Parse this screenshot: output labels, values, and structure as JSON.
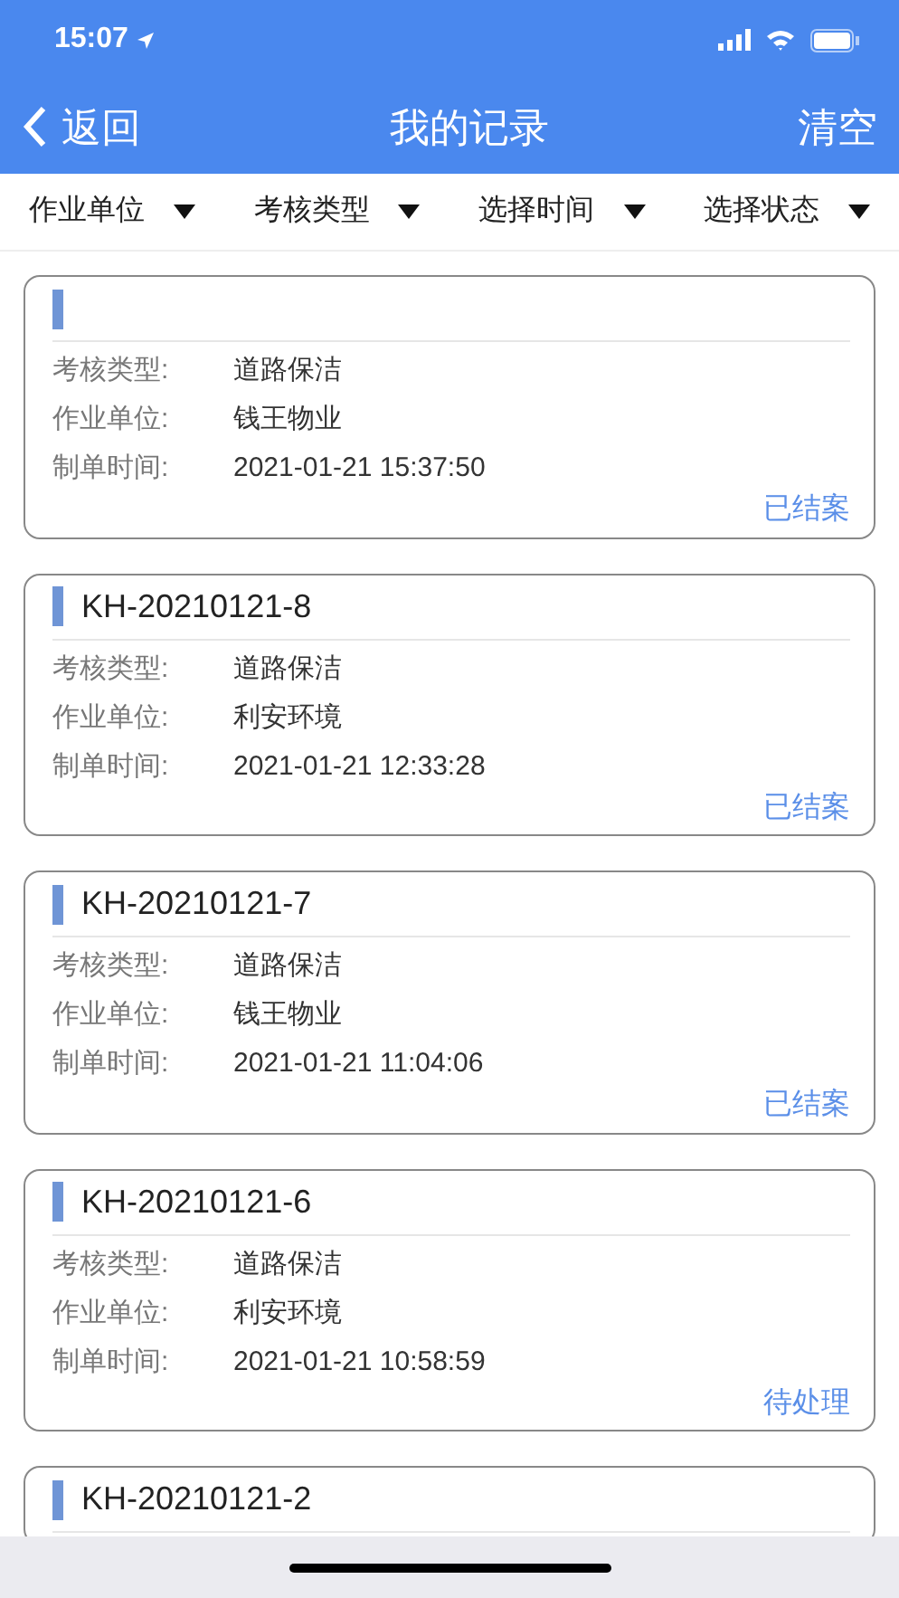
{
  "status_bar": {
    "time": "15:07"
  },
  "header": {
    "back": "返回",
    "title": "我的记录",
    "action": "清空"
  },
  "filters": [
    {
      "label": "作业单位"
    },
    {
      "label": "考核类型"
    },
    {
      "label": "选择时间"
    },
    {
      "label": "选择状态"
    }
  ],
  "records": [
    {
      "fields": [
        {
          "label": "考核类型:",
          "value": "道路保洁"
        },
        {
          "label": "作业单位:",
          "value": "钱王物业"
        },
        {
          "label": "制单时间:",
          "value": "2021-01-21 15:37:50"
        }
      ],
      "status": "已结案"
    },
    {
      "number": "KH-20210121-8",
      "fields": [
        {
          "label": "考核类型:",
          "value": "道路保洁"
        },
        {
          "label": "作业单位:",
          "value": "利安环境"
        },
        {
          "label": "制单时间:",
          "value": "2021-01-21 12:33:28"
        }
      ],
      "status": "已结案"
    },
    {
      "number": "KH-20210121-7",
      "fields": [
        {
          "label": "考核类型:",
          "value": "道路保洁"
        },
        {
          "label": "作业单位:",
          "value": "钱王物业"
        },
        {
          "label": "制单时间:",
          "value": "2021-01-21 11:04:06"
        }
      ],
      "status": "已结案"
    },
    {
      "number": "KH-20210121-6",
      "fields": [
        {
          "label": "考核类型:",
          "value": "道路保洁"
        },
        {
          "label": "作业单位:",
          "value": "利安环境"
        },
        {
          "label": "制单时间:",
          "value": "2021-01-21 10:58:59"
        }
      ],
      "status": "待处理"
    },
    {
      "number": "KH-20210121-2"
    }
  ]
}
